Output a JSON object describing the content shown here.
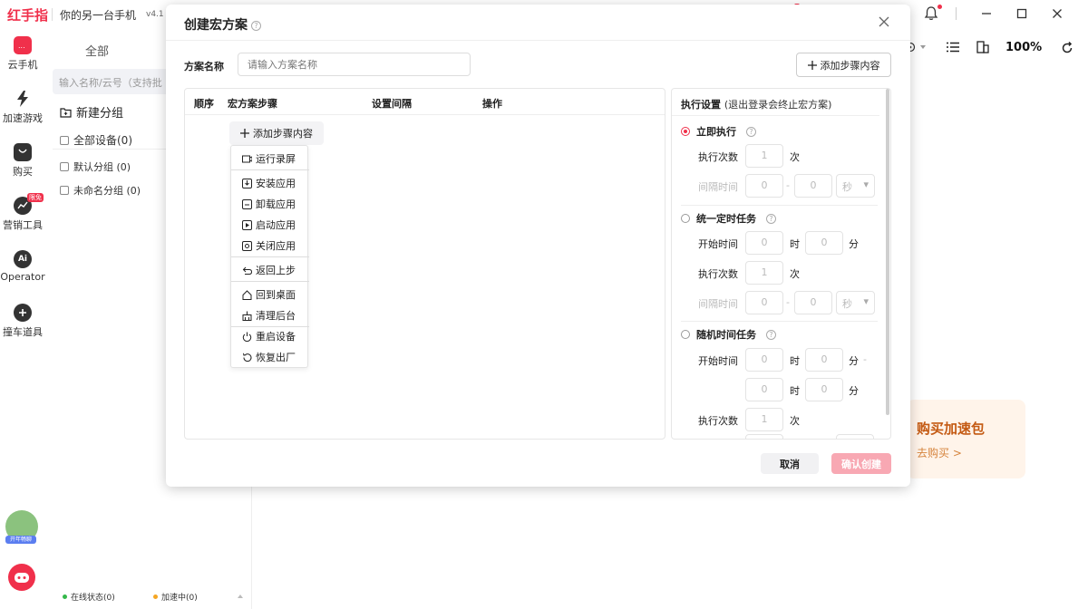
{
  "app": {
    "logo_text": "红手指",
    "title": "你的另一台手机",
    "version": "v4.1"
  },
  "toolbar": {
    "zoom": "100%"
  },
  "sidebar": {
    "items": [
      {
        "label": "云手机",
        "icon": "phone-icon"
      },
      {
        "label": "加速游戏",
        "icon": "lightning-icon"
      },
      {
        "label": "购买",
        "icon": "shopping-bag-icon"
      },
      {
        "label": "营销工具",
        "icon": "chart-icon",
        "badge": "限免"
      },
      {
        "label": "Operator",
        "icon": "ai-icon"
      },
      {
        "label": "撞车道具",
        "icon": "pin-icon"
      }
    ],
    "avatar_tag": "开年畅聊"
  },
  "device_panel": {
    "tab_all": "全部",
    "search_placeholder": "输入名称/云号（支持批",
    "new_group": "新建分组",
    "groups": [
      {
        "label": "全部设备(0)"
      },
      {
        "label": "默认分组 (0)"
      },
      {
        "label": "未命名分组 (0)"
      }
    ],
    "status_online": "在线状态(0)",
    "status_accel": "加速中(0)",
    "colors": {
      "online": "#34b84a",
      "accel": "#f5a623"
    }
  },
  "promo": {
    "title": "购买加速包",
    "link": "去购买 >"
  },
  "modal": {
    "title": "创建宏方案",
    "name_label": "方案名称",
    "name_placeholder": "请输入方案名称",
    "add_step_label": "添加步骤内容",
    "columns": [
      "顺序",
      "宏方案步骤",
      "设置间隔",
      "操作"
    ],
    "menu": [
      {
        "label": "运行录屏",
        "icon": "record-icon"
      },
      {
        "label": "安装应用",
        "icon": "install-icon"
      },
      {
        "label": "卸载应用",
        "icon": "uninstall-icon"
      },
      {
        "label": "启动应用",
        "icon": "launch-icon"
      },
      {
        "label": "关闭应用",
        "icon": "close-app-icon"
      },
      {
        "label": "返回上步",
        "icon": "back-icon"
      },
      {
        "label": "回到桌面",
        "icon": "home-icon"
      },
      {
        "label": "清理后台",
        "icon": "clean-icon"
      },
      {
        "label": "重启设备",
        "icon": "power-icon"
      },
      {
        "label": "恢复出厂",
        "icon": "reset-icon"
      }
    ],
    "exec": {
      "title": "执行设置",
      "subtitle": "(退出登录会终止宏方案)",
      "options": [
        {
          "label": "立即执行",
          "selected": true
        },
        {
          "label": "统一定时任务",
          "selected": false
        },
        {
          "label": "随机时间任务",
          "selected": false
        }
      ],
      "exec_count_label": "执行次数",
      "interval_label": "间隔时间",
      "start_time_label": "开始时间",
      "count_value": "1",
      "zero_value": "0",
      "unit_times": "次",
      "unit_hour": "时",
      "unit_minute": "分",
      "unit_second": "秒",
      "dash": "-"
    },
    "cancel": "取消",
    "confirm": "确认创建"
  }
}
